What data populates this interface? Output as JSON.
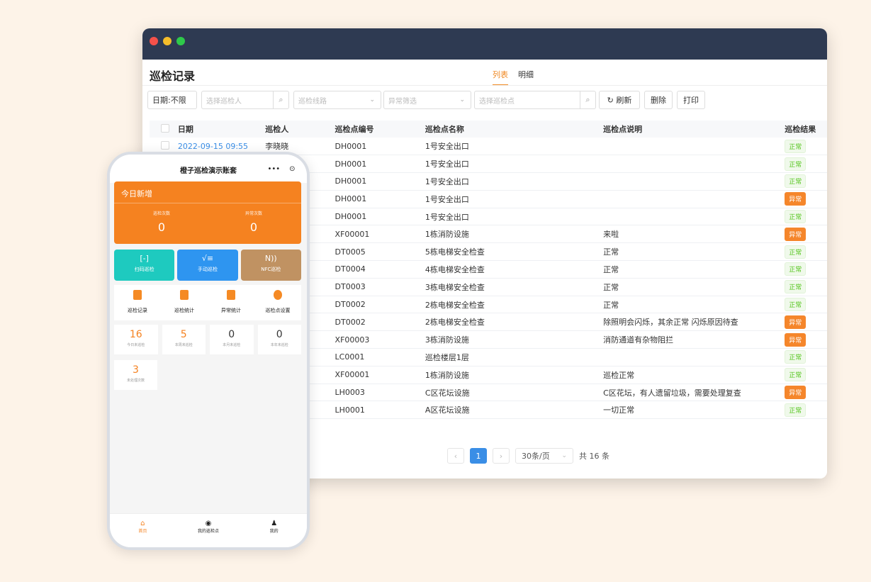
{
  "desktop": {
    "page_title": "巡检记录",
    "tabs": [
      {
        "label": "列表",
        "active": true
      },
      {
        "label": "明细",
        "active": false
      }
    ],
    "filters": {
      "date": "日期:不限",
      "person_placeholder": "选择巡检人",
      "route_placeholder": "巡检线路",
      "abnormal_placeholder": "异常筛选",
      "point_placeholder": "选择巡检点"
    },
    "buttons": {
      "refresh": "↻ 刷新",
      "delete": "删除",
      "print": "打印"
    },
    "columns": [
      "日期",
      "巡检人",
      "巡检点编号",
      "巡检点名称",
      "巡检点说明",
      "巡检结果"
    ],
    "rows": [
      {
        "date": "2022-09-15 09:55",
        "person": "李晓晓",
        "code": "DH0001",
        "name": "1号安全出口",
        "desc": "",
        "result": "正常"
      },
      {
        "date": "",
        "person": "",
        "code": "DH0001",
        "name": "1号安全出口",
        "desc": "",
        "result": "正常"
      },
      {
        "date": "",
        "person": "",
        "code": "DH0001",
        "name": "1号安全出口",
        "desc": "",
        "result": "正常"
      },
      {
        "date": "",
        "person": "",
        "code": "DH0001",
        "name": "1号安全出口",
        "desc": "",
        "result": "异常"
      },
      {
        "date": "",
        "person": "",
        "code": "DH0001",
        "name": "1号安全出口",
        "desc": "",
        "result": "正常"
      },
      {
        "date": "",
        "person": "",
        "code": "XF00001",
        "name": "1栋消防设施",
        "desc": "来啦",
        "result": "异常"
      },
      {
        "date": "",
        "person": "",
        "code": "DT0005",
        "name": "5栋电梯安全检查",
        "desc": "正常",
        "result": "正常"
      },
      {
        "date": "",
        "person": "",
        "code": "DT0004",
        "name": "4栋电梯安全检查",
        "desc": "正常",
        "result": "正常"
      },
      {
        "date": "",
        "person": "",
        "code": "DT0003",
        "name": "3栋电梯安全检查",
        "desc": "正常",
        "result": "正常"
      },
      {
        "date": "",
        "person": "",
        "code": "DT0002",
        "name": "2栋电梯安全检查",
        "desc": "正常",
        "result": "正常"
      },
      {
        "date": "",
        "person": "",
        "code": "DT0002",
        "name": "2栋电梯安全检查",
        "desc": "除照明会闪烁，其余正常 闪烁原因待查",
        "result": "异常"
      },
      {
        "date": "",
        "person": "",
        "code": "XF00003",
        "name": "3栋消防设施",
        "desc": "消防通道有杂物阻拦",
        "result": "异常"
      },
      {
        "date": "",
        "person": "",
        "code": "LC0001",
        "name": "巡检楼层1层",
        "desc": "",
        "result": "正常"
      },
      {
        "date": "",
        "person": "",
        "code": "XF00001",
        "name": "1栋消防设施",
        "desc": "巡检正常",
        "result": "正常"
      },
      {
        "date": "",
        "person": "",
        "code": "LH0003",
        "name": "C区花坛设施",
        "desc": "C区花坛，有人遗留垃圾，需要处理复查",
        "result": "异常"
      },
      {
        "date": "",
        "person": "",
        "code": "LH0001",
        "name": "A区花坛设施",
        "desc": "一切正常",
        "result": "正常"
      }
    ],
    "pagination": {
      "prev": "‹",
      "current": "1",
      "next": "›",
      "page_size": "30条/页",
      "total": "共 16 条"
    }
  },
  "phone": {
    "title": "橙子巡检演示账套",
    "capsule_more": "•••",
    "capsule_close": "⊙",
    "today": {
      "title": "今日新增",
      "stats": [
        {
          "label": "巡检次数",
          "value": "0"
        },
        {
          "label": "异常次数",
          "value": "0"
        }
      ]
    },
    "actions": [
      {
        "label": "扫码巡检",
        "icon": "[-]"
      },
      {
        "label": "手动巡检",
        "icon": "√≡"
      },
      {
        "label": "NFC巡检",
        "icon": "N))"
      }
    ],
    "menu": [
      "巡检记录",
      "巡检统计",
      "异常统计",
      "巡检点设置"
    ],
    "counts": [
      {
        "value": "16",
        "label": "今日未巡检"
      },
      {
        "value": "5",
        "label": "本周未巡检"
      },
      {
        "value": "0",
        "label": "本月未巡检"
      },
      {
        "value": "0",
        "label": "本年未巡检"
      }
    ],
    "pending": {
      "value": "3",
      "label": "未处理次数"
    },
    "tabbar": [
      {
        "label": "首页",
        "icon": "⌂"
      },
      {
        "label": "我的巡检点",
        "icon": "◉"
      },
      {
        "label": "我的",
        "icon": "♟"
      }
    ]
  }
}
